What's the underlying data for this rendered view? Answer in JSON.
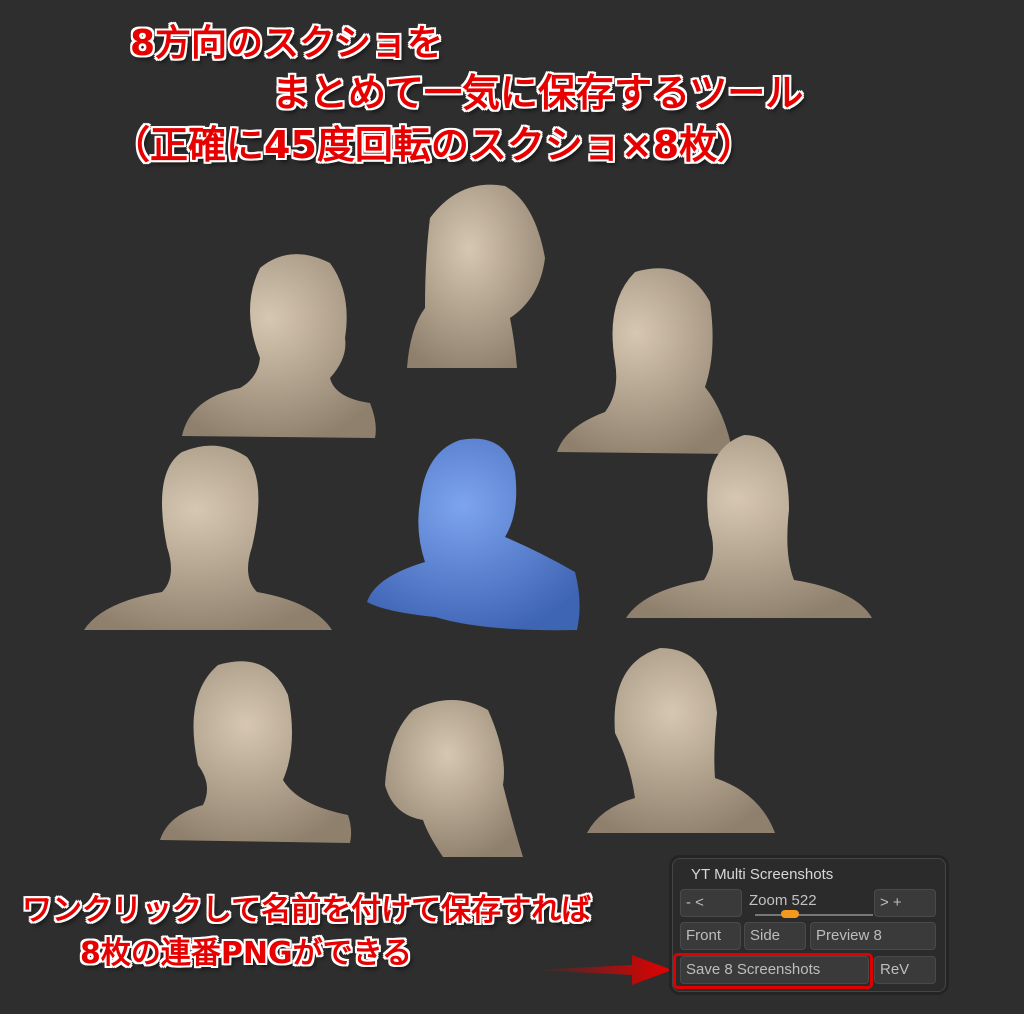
{
  "headline": {
    "line1": "8方向のスクショを",
    "line2": "まとめて一気に保存するツール",
    "line3": "（正確に45度回転のスクショ×8枚）"
  },
  "caption": {
    "line1": "ワンクリックして名前を付けて保存すれば",
    "line2": "8枚の連番PNGができる"
  },
  "colors": {
    "accent_red": "#e60000",
    "clay": "#bfae98",
    "selected_blue": "#5b84d6",
    "slider_orange": "#f39a1e"
  },
  "heads": [
    {
      "label": "three-quarter-right",
      "selected": false
    },
    {
      "label": "profile-right",
      "selected": false
    },
    {
      "label": "three-quarter-back-right",
      "selected": false
    },
    {
      "label": "front",
      "selected": false
    },
    {
      "label": "perspective-selected",
      "selected": true
    },
    {
      "label": "back",
      "selected": false
    },
    {
      "label": "three-quarter-left",
      "selected": false
    },
    {
      "label": "profile-left",
      "selected": false
    },
    {
      "label": "three-quarter-back-left",
      "selected": false
    }
  ],
  "panel": {
    "title": "YT Multi Screenshots",
    "zoom_down": "- <",
    "zoom_label": "Zoom",
    "zoom_value": "522",
    "zoom_up": "> +",
    "front": "Front",
    "side": "Side",
    "preview": "Preview 8",
    "save": "Save 8 Screenshots",
    "rev": "ReV"
  }
}
